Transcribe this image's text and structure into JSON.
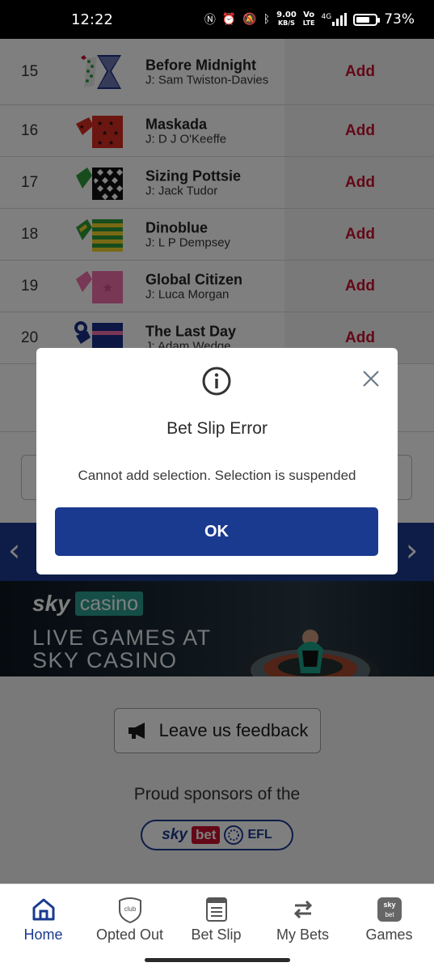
{
  "status_bar": {
    "time": "12:22",
    "network_speed": "9.00",
    "network_speed_unit": "KB/S",
    "volte_label": "Vo",
    "lte_label": "LTE",
    "signal_label": "4G",
    "battery_level": 0.73,
    "battery_text": "73%"
  },
  "runners": [
    {
      "number": "15",
      "horse": "Before Midnight",
      "jockey": "J: Sam Twiston-Davies",
      "action": "Add"
    },
    {
      "number": "16",
      "horse": "Maskada",
      "jockey": "J: D J O'Keeffe",
      "action": "Add"
    },
    {
      "number": "17",
      "horse": "Sizing Pottsie",
      "jockey": "J: Jack Tudor",
      "action": "Add"
    },
    {
      "number": "18",
      "horse": "Dinoblue",
      "jockey": "J: L P Dempsey",
      "action": "Add"
    },
    {
      "number": "19",
      "horse": "Global Citizen",
      "jockey": "J: Luca Morgan",
      "action": "Add"
    },
    {
      "number": "20",
      "horse": "The Last Day",
      "jockey": "J: Adam Wedge",
      "action": "Add"
    }
  ],
  "promo": {
    "brand": "sky",
    "product": "casino",
    "headline": "LIVE GAMES AT SKY CASINO"
  },
  "feedback": {
    "label": "Leave us feedback"
  },
  "sponsors": {
    "text": "Proud sponsors of the",
    "badge_sky": "sky",
    "badge_bet": "bet",
    "badge_efl": "EFL"
  },
  "modal": {
    "title": "Bet Slip Error",
    "message": "Cannot add selection. Selection is suspended",
    "ok_label": "OK"
  },
  "nav": {
    "items": [
      {
        "label": "Home",
        "icon": "home-icon",
        "active": true
      },
      {
        "label": "Opted Out",
        "icon": "club-shield-icon",
        "icon_text": "club",
        "active": false
      },
      {
        "label": "Bet Slip",
        "icon": "bet-slip-icon",
        "active": false
      },
      {
        "label": "My Bets",
        "icon": "refresh-arrows-icon",
        "active": false
      },
      {
        "label": "Games",
        "icon": "sky-bet-games-icon",
        "icon_text_top": "sky",
        "icon_text_bottom": "bet",
        "active": false
      }
    ]
  },
  "colors": {
    "brand_blue": "#1a3a8f",
    "add_red": "#c8102e",
    "overlay": "rgba(0,0,0,0.5)"
  }
}
